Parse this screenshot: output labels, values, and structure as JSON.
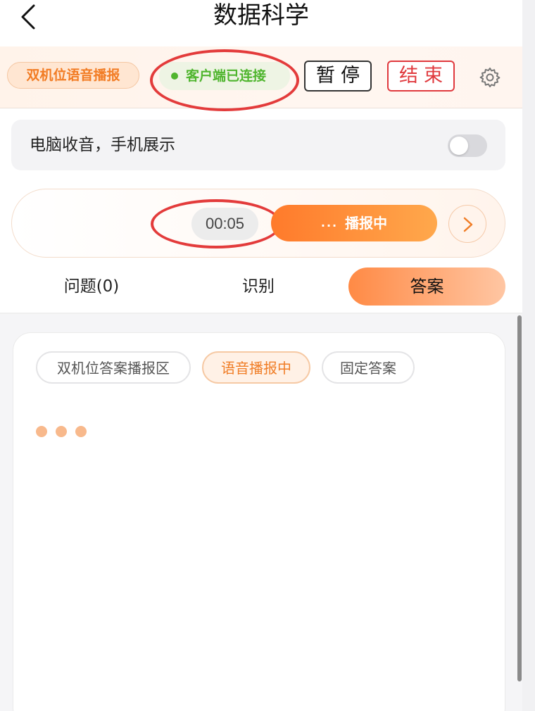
{
  "header": {
    "title": "数据科学",
    "back_icon": "chevron-left-icon"
  },
  "toolbar": {
    "mode_label": "双机位语音播报",
    "connection_label": "客户端已连接",
    "connection_color": "#4fb52e",
    "pause_label": "暂停",
    "end_label": "结束",
    "settings_icon": "gear-icon"
  },
  "audio_toggle": {
    "label": "电脑收音，手机展示",
    "enabled": false
  },
  "player": {
    "timer": "00:05",
    "status_label": "播报中",
    "status_indicator": "...",
    "next_icon": "chevron-right-icon"
  },
  "tabs": [
    {
      "label": "问题(0)",
      "active": false
    },
    {
      "label": "识别",
      "active": false
    },
    {
      "label": "答案",
      "active": true
    }
  ],
  "content": {
    "chips": [
      {
        "label": "双机位答案播报区",
        "active": false
      },
      {
        "label": "语音播报中",
        "active": true
      },
      {
        "label": "固定答案",
        "active": false
      }
    ]
  },
  "colors": {
    "accent": "#ff7a2b",
    "annotation": "#e33b3b",
    "danger": "#e0393d"
  }
}
